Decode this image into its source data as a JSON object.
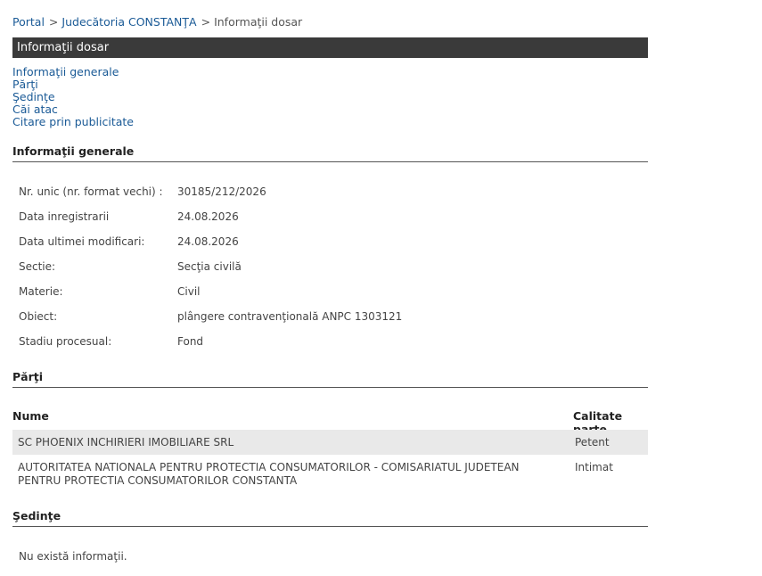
{
  "breadcrumb": {
    "items": [
      "Portal",
      "Judecătoria CONSTANŢA"
    ],
    "separator": ">",
    "current": "Informaţii dosar"
  },
  "header": {
    "title": "Informaţii dosar"
  },
  "toc": [
    "Informaţii generale",
    "Părţi",
    "Şedinţe",
    "Căi atac",
    "Citare prin publicitate"
  ],
  "sections": {
    "general": "Informaţii generale",
    "parties": "Părţi",
    "hearings": "Şedinţe"
  },
  "general_info": [
    {
      "label": "Nr. unic (nr. format vechi) :",
      "value": "30185/212/2026"
    },
    {
      "label": "Data inregistrarii",
      "value": "24.08.2026"
    },
    {
      "label": "Data ultimei modificari:",
      "value": "24.08.2026"
    },
    {
      "label": "Sectie:",
      "value": "Secţia civilă"
    },
    {
      "label": "Materie:",
      "value": "Civil"
    },
    {
      "label": "Obiect:",
      "value": "plângere contravenţională ANPC 1303121"
    },
    {
      "label": "Stadiu procesual:",
      "value": "Fond"
    }
  ],
  "parties": {
    "columns": [
      "Nume",
      "Calitate parte"
    ],
    "rows": [
      {
        "name": "SC PHOENIX INCHIRIERI IMOBILIARE SRL",
        "role": "Petent"
      },
      {
        "name": "AUTORITATEA NATIONALA PENTRU PROTECTIA CONSUMATORILOR - COMISARIATUL JUDETEAN PENTRU PROTECTIA CONSUMATORILOR CONSTANTA",
        "role": "Intimat"
      }
    ]
  },
  "hearings": {
    "empty_text": "Nu există informaţii."
  },
  "colors": {
    "link": "#1a5a96",
    "header_bg": "#3a3a3a",
    "row_shade": "#e9e9e9"
  }
}
